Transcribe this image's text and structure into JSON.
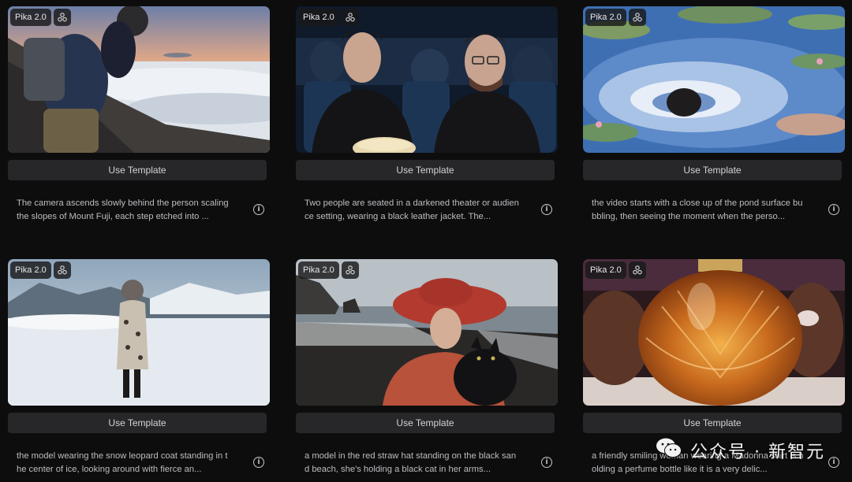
{
  "cards": [
    {
      "badge": "Pika 2.0",
      "button": "Use Template",
      "description": "The camera ascends slowly behind the person scaling the slopes of Mount Fuji, each step etched into ..."
    },
    {
      "badge": "Pika 2.0",
      "button": "Use Template",
      "description": "Two people are seated in a darkened theater or audience setting, wearing a black leather jacket. The..."
    },
    {
      "badge": "Pika 2.0",
      "button": "Use Template",
      "description": "the video starts with a close up of the pond surface bubbling, then seeing the moment when the perso..."
    },
    {
      "badge": "Pika 2.0",
      "button": "Use Template",
      "description": "the model wearing the snow leopard coat standing in the center of ice, looking around with fierce an..."
    },
    {
      "badge": "Pika 2.0",
      "button": "Use Template",
      "description": "a model in the red straw hat standing on the black sand beach, she's holding a black cat in her arms..."
    },
    {
      "badge": "Pika 2.0",
      "button": "Use Template",
      "description": "a friendly smiling woman wearing a Madonna shirt is holding a perfume bottle like it is a very delic..."
    }
  ],
  "watermark": {
    "text": "公众号 · 新智元"
  }
}
